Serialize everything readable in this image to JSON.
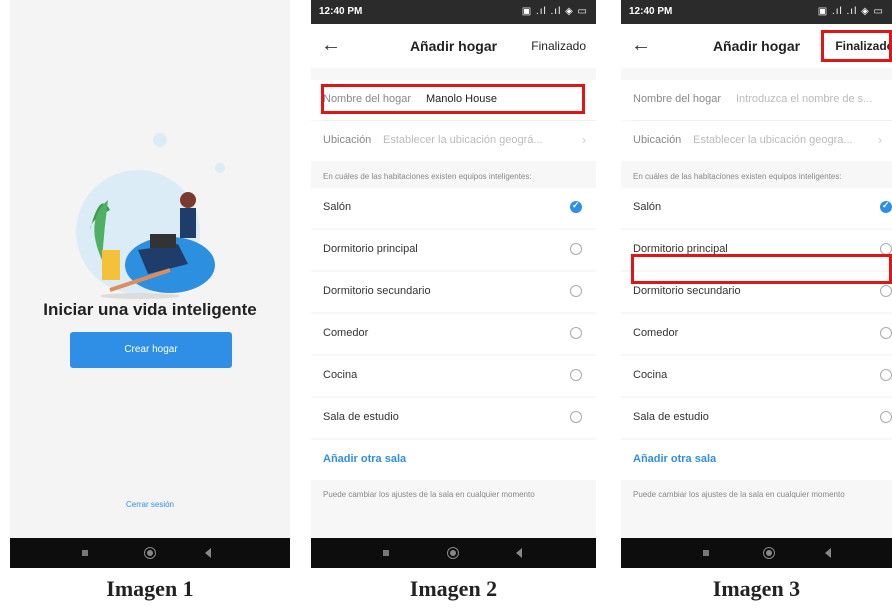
{
  "screen1": {
    "headline": "Iniciar una vida inteligente",
    "create_button": "Crear hogar",
    "logout_link": "Cerrar sesión"
  },
  "screen2": {
    "status_time": "12:40 PM",
    "status_icons": "▣ .ıl .ıl ◈ ▭",
    "nav": {
      "back": "←",
      "title": "Añadir hogar",
      "done": "Finalizado"
    },
    "home_name": {
      "label": "Nombre del hogar",
      "value": "Manolo House"
    },
    "location": {
      "label": "Ubicación",
      "placeholder": "Establecer la ubicación geográ...",
      "chevron": "›"
    },
    "rooms_note": "En cuáles de las habitaciones existen equipos inteligentes:",
    "rooms": [
      {
        "name": "Salón",
        "checked": true
      },
      {
        "name": "Dormitorio principal",
        "checked": false
      },
      {
        "name": "Dormitorio secundario",
        "checked": false
      },
      {
        "name": "Comedor",
        "checked": false
      },
      {
        "name": "Cocina",
        "checked": false
      },
      {
        "name": "Sala de estudio",
        "checked": false
      }
    ],
    "add_room": "Añadir otra sala",
    "footer_note": "Puede cambiar los ajustes de la sala en cualquier momento"
  },
  "screen3": {
    "status_time": "12:40 PM",
    "status_icons": "▣ .ıl .ıl ◈ ▭",
    "nav": {
      "back": "←",
      "title": "Añadir hogar",
      "done": "Finalizado"
    },
    "home_name": {
      "label": "Nombre del hogar",
      "placeholder": "Introduzca el nombre de s..."
    },
    "location": {
      "label": "Ubicación",
      "placeholder": "Establecer la ubicación geogra...",
      "chevron": "›"
    },
    "rooms_note": "En cuáles de las habitaciones existen equipos inteligentes:",
    "rooms": [
      {
        "name": "Salón",
        "checked": true
      },
      {
        "name": "Dormitorio principal",
        "checked": false
      },
      {
        "name": "Dormitorio secundario",
        "checked": false
      },
      {
        "name": "Comedor",
        "checked": false
      },
      {
        "name": "Cocina",
        "checked": false
      },
      {
        "name": "Sala de estudio",
        "checked": false
      }
    ],
    "add_room": "Añadir otra sala",
    "footer_note": "Puede cambiar los ajustes de la sala en cualquier momento"
  },
  "captions": [
    "Imagen 1",
    "Imagen 2",
    "Imagen 3"
  ],
  "colors": {
    "accent": "#2f8fe6",
    "highlight": "#e01616",
    "statusbar": "#2b2b2b",
    "navbar": "#0d0d0d"
  }
}
